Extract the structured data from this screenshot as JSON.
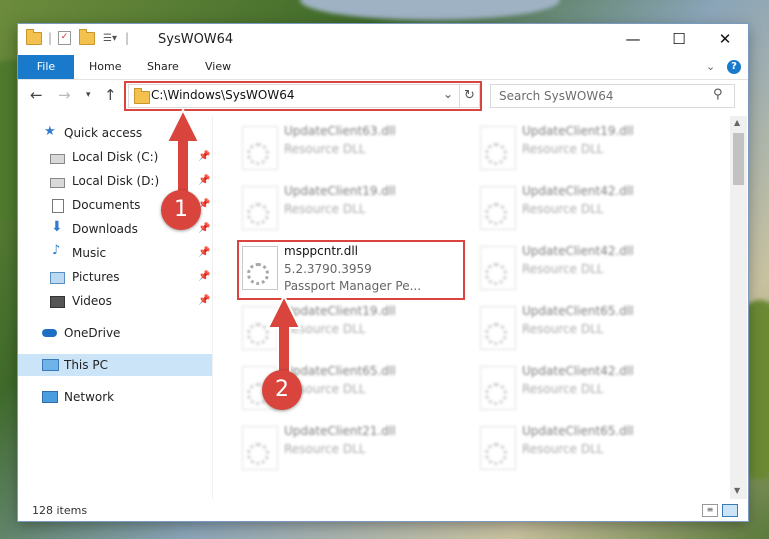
{
  "window": {
    "title": "SysWOW64",
    "minimize": "—",
    "maximize": "☐",
    "close": "✕"
  },
  "ribbon": {
    "tabs": [
      "File",
      "Home",
      "Share",
      "View"
    ],
    "help": "?",
    "expand": "⌄"
  },
  "address": {
    "path": "C:\\Windows\\SysWOW64",
    "search_placeholder": "Search SysWOW64"
  },
  "sidebar": {
    "quick_access": "Quick access",
    "items": [
      {
        "label": "Local Disk (C:)",
        "icon": "drive-icon"
      },
      {
        "label": "Local Disk (D:)",
        "icon": "drive-icon"
      },
      {
        "label": "Documents",
        "icon": "documents-icon"
      },
      {
        "label": "Downloads",
        "icon": "downloads-icon"
      },
      {
        "label": "Music",
        "icon": "music-icon"
      },
      {
        "label": "Pictures",
        "icon": "pictures-icon"
      },
      {
        "label": "Videos",
        "icon": "videos-icon"
      }
    ],
    "onedrive": "OneDrive",
    "this_pc": "This PC",
    "network": "Network"
  },
  "files": [
    {
      "name": "UpdateClient63.dll",
      "desc": "Resource DLL"
    },
    {
      "name": "UpdateClient19.dll",
      "desc": "Resource DLL"
    },
    {
      "name": "UpdateClient19.dll",
      "desc": "Resource DLL"
    },
    {
      "name": "UpdateClient42.dll",
      "desc": "Resource DLL"
    },
    {
      "name": "msppcntr.dll",
      "desc": "5.2.3790.3959",
      "desc2": "Passport Manager Pe..."
    },
    {
      "name": "UpdateClient42.dll",
      "desc": "Resource DLL"
    },
    {
      "name": "UpdateClient19.dll",
      "desc": "Resource DLL"
    },
    {
      "name": "UpdateClient65.dll",
      "desc": "Resource DLL"
    },
    {
      "name": "UpdateClient65.dll",
      "desc": "Resource DLL"
    },
    {
      "name": "UpdateClient42.dll",
      "desc": "Resource DLL"
    },
    {
      "name": "UpdateClient21.dll",
      "desc": "Resource DLL"
    },
    {
      "name": "UpdateClient65.dll",
      "desc": "Resource DLL"
    }
  ],
  "status": {
    "count": "128 items"
  },
  "annotations": {
    "step1": "1",
    "step2": "2"
  },
  "colors": {
    "accent": "#1979ca",
    "highlight_red": "#d9443c",
    "selected_nav": "#cce4f7"
  }
}
